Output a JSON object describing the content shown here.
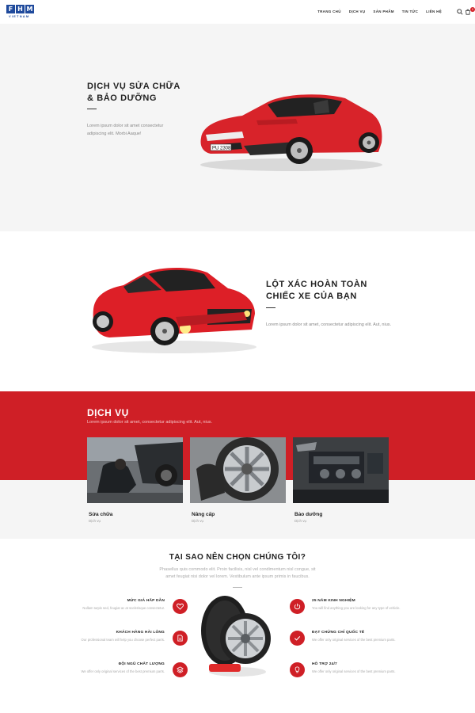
{
  "header": {
    "logo_letters": [
      "F",
      "H",
      "M"
    ],
    "logo_sub": "VIETNAM",
    "nav": [
      "TRANG CHỦ",
      "DỊCH VỤ",
      "SẢN PHẨM",
      "TIN TỨC",
      "LIÊN HỆ"
    ],
    "cart_count": "0",
    "search_icon": "search-icon",
    "cart_icon": "cart-icon"
  },
  "hero1": {
    "title": "DỊCH VỤ SỬA CHỮA\n& BẢO DƯỠNG",
    "desc": "Lorem ipsum dolor sit amet consectetur adipiscing elit. Morbi Aaque!",
    "plate": "PU 2308"
  },
  "hero2": {
    "title": "LỘT XÁC HOÀN TOÀN\nCHIẾC XE CỦA BẠN",
    "desc": "Lorem ipsum dolor sit amet, consectetur adipiscing elit. Aut, nius."
  },
  "services": {
    "title": "DỊCH VỤ",
    "subtitle": "Lorem ipsum dolor sit amet, consectetur adipiscing elit. Aut, nius.",
    "items": [
      {
        "name": "Sửa chữa",
        "category": "Dịch vụ"
      },
      {
        "name": "Nâng cấp",
        "category": "Dịch vụ"
      },
      {
        "name": "Bảo dưỡng",
        "category": "Dịch vụ"
      }
    ]
  },
  "why": {
    "title": "TẠI SAO NÊN CHỌN CHÚNG TÔI?",
    "desc": "Phasellus quis commodo elit. Proin facilisis, nisl vel condimentum nisl congue, sit amet feugiat nisi dolor vel lorem. Vestibulum ante ipsum primis in faucibus.",
    "left": [
      {
        "title": "MỨC GIÁ HẤP DẪN",
        "desc": "Nullam turpis sed, feugiat ac at scelerisque consectetur.",
        "icon": "heart-icon"
      },
      {
        "title": "KHÁCH HÀNG HÀI LÒNG",
        "desc": "Our professional team will help you choose perfect parts.",
        "icon": "document-icon"
      },
      {
        "title": "ĐỘI NGŨ CHẤT LƯỢNG",
        "desc": "We offer only original services of the best premium parts.",
        "icon": "layers-icon"
      }
    ],
    "right": [
      {
        "title": "25 NĂM KINH NGHIỆM",
        "desc": "You will find anything you are looking for any type of vehicle.",
        "icon": "power-icon"
      },
      {
        "title": "ĐẠT CHỨNG CHỈ QUỐC TẾ",
        "desc": "We offer only original services of the best premium parts.",
        "icon": "check-icon"
      },
      {
        "title": "HỖ TRỢ 24/7",
        "desc": "We offer only original services of the best premium parts.",
        "icon": "bulb-icon"
      }
    ]
  },
  "colors": {
    "accent": "#cf1f26",
    "brand": "#1f4a9c"
  }
}
